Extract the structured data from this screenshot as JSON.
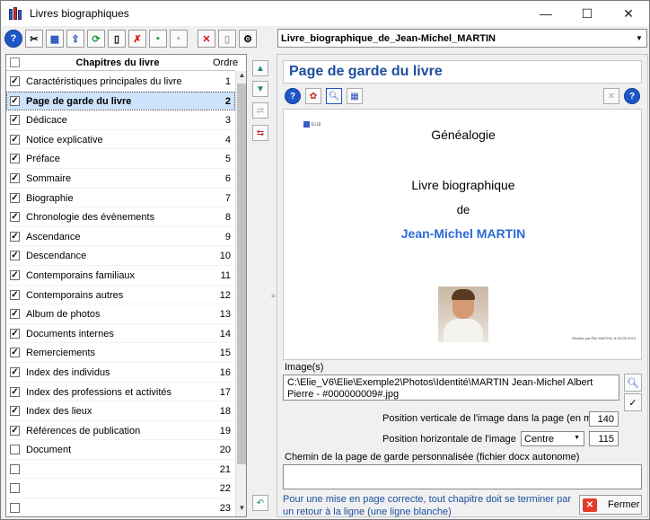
{
  "window": {
    "title": "Livres biographiques",
    "minimize": "—",
    "maximize": "☐",
    "close": "✕"
  },
  "toolbar": {
    "buttons": [
      {
        "name": "help-button",
        "glyph": "?",
        "cls": "help"
      },
      {
        "name": "tools-button",
        "glyph": "✂",
        "cls": ""
      },
      {
        "name": "grid-button",
        "glyph": "▦",
        "cls": "blue"
      },
      {
        "name": "export-button",
        "glyph": "⇪",
        "cls": "blue"
      },
      {
        "name": "refresh-button",
        "glyph": "⟳",
        "cls": "green"
      },
      {
        "name": "new-book-button",
        "glyph": "▯",
        "cls": ""
      },
      {
        "name": "delete-book-button",
        "glyph": "✗",
        "cls": "red"
      },
      {
        "name": "save-button",
        "glyph": "▪",
        "cls": "green"
      },
      {
        "name": "save-disabled-button",
        "glyph": "▪",
        "cls": "gray"
      },
      {
        "name": "sep",
        "glyph": "",
        "cls": "sep"
      },
      {
        "name": "cancel-button",
        "glyph": "✕",
        "cls": "red"
      },
      {
        "name": "blank-page-button",
        "glyph": "▯",
        "cls": "gray"
      },
      {
        "name": "settings-button",
        "glyph": "⚙",
        "cls": ""
      }
    ],
    "book_select": "Livre_biographique_de_Jean-Michel_MARTIN"
  },
  "chapters": {
    "header_title": "Chapitres du livre",
    "header_order": "Ordre",
    "rows": [
      {
        "name": "Caractéristiques principales du livre",
        "order": "1",
        "checked": true
      },
      {
        "name": "Page de garde du livre",
        "order": "2",
        "checked": true,
        "selected": true
      },
      {
        "name": "Dédicace",
        "order": "3",
        "checked": true
      },
      {
        "name": "Notice explicative",
        "order": "4",
        "checked": true
      },
      {
        "name": "Préface",
        "order": "5",
        "checked": true
      },
      {
        "name": "Sommaire",
        "order": "6",
        "checked": true
      },
      {
        "name": "Biographie",
        "order": "7",
        "checked": true
      },
      {
        "name": "Chronologie des évènements",
        "order": "8",
        "checked": true
      },
      {
        "name": "Ascendance",
        "order": "9",
        "checked": true
      },
      {
        "name": "Descendance",
        "order": "10",
        "checked": true
      },
      {
        "name": "Contemporains familiaux",
        "order": "11",
        "checked": true
      },
      {
        "name": "Contemporains autres",
        "order": "12",
        "checked": true
      },
      {
        "name": "Album de photos",
        "order": "13",
        "checked": true
      },
      {
        "name": "Documents internes",
        "order": "14",
        "checked": true
      },
      {
        "name": "Remerciements",
        "order": "15",
        "checked": true
      },
      {
        "name": "Index des individus",
        "order": "16",
        "checked": true
      },
      {
        "name": "Index des professions et activités",
        "order": "17",
        "checked": true
      },
      {
        "name": "Index des lieux",
        "order": "18",
        "checked": true
      },
      {
        "name": "Références de publication",
        "order": "19",
        "checked": true
      },
      {
        "name": "Document",
        "order": "20",
        "checked": false
      },
      {
        "name": "",
        "order": "21",
        "checked": false
      },
      {
        "name": "",
        "order": "22",
        "checked": false
      },
      {
        "name": "",
        "order": "23",
        "checked": false
      }
    ]
  },
  "panel": {
    "title": "Page de garde du livre",
    "preview": {
      "logo": "ELIE",
      "line1": "Généalogie",
      "line2": "Livre biographique",
      "line3": "de",
      "name": "Jean-Michel MARTIN",
      "footer": "Réalisé par Élie MARTIN, le 09.05.2019"
    },
    "images_label": "Image(s)",
    "image_path": "C:\\Elie_V6\\Elie\\Exemple2\\Photos\\Identité\\MARTIN Jean-Michel Albert Pierre - #000000009#.jpg",
    "vpos_label": "Position verticale de l'image dans la page (en mm)",
    "vpos_value": "140",
    "hpos_label": "Position horizontale de l'image",
    "hpos_option": "Centre",
    "hpos_value": "115",
    "docx_label": "Chemin de la page de garde personnalisée (fichier docx autonome)",
    "docx_value": "",
    "hint": "Pour une mise en page correcte, tout chapitre doit se terminer par un retour à la ligne (une ligne blanche)",
    "close_label": "Fermer"
  }
}
